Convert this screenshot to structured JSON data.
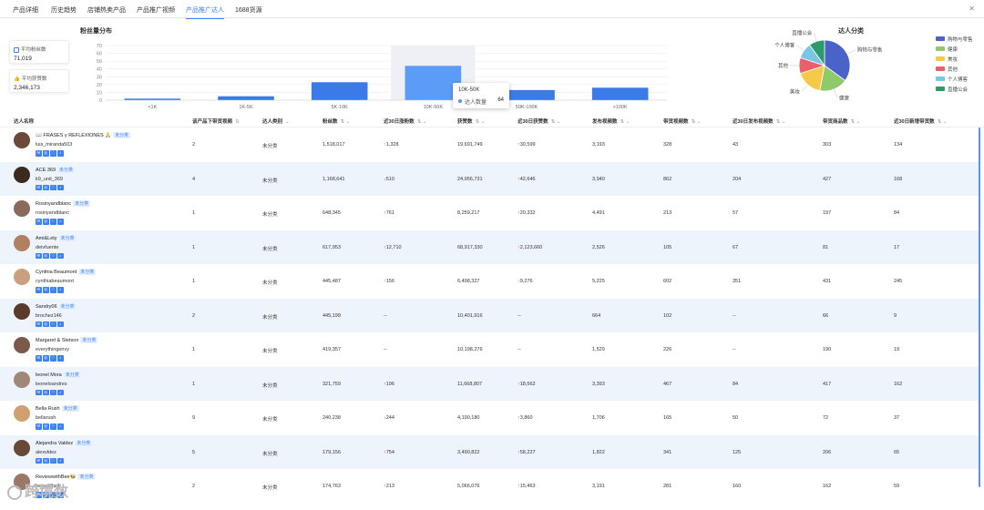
{
  "tabs": [
    "产品详细",
    "历史趋势",
    "店铺热卖产品",
    "产品推广视频",
    "产品推广达人",
    "1688货源"
  ],
  "active_tab": 4,
  "cards": [
    {
      "label": "平均粉丝数",
      "value": "71,019"
    },
    {
      "label": "平均获赞数",
      "value": "2,346,173"
    }
  ],
  "bar_title": "粉丝量分布",
  "pie_title": "达人分类",
  "chart_data": [
    {
      "type": "bar",
      "title": "粉丝量分布",
      "categories": [
        "<1K",
        "1K-5K",
        "5K-10K",
        "10K-50K",
        "50K-100K",
        ">100K"
      ],
      "values": [
        2,
        5,
        23,
        44,
        13,
        16
      ],
      "ylim": [
        0,
        70
      ],
      "yticks": [
        0,
        10,
        20,
        30,
        40,
        50,
        60,
        70
      ],
      "color": "#3b7be8",
      "highlight": {
        "category": "10K-50K",
        "label": "达人数量",
        "value": "64"
      }
    },
    {
      "type": "pie",
      "title": "达人分类",
      "slices": [
        {
          "name": "购物与零售",
          "value": 35,
          "color": "#4a63c8"
        },
        {
          "name": "健康",
          "value": 18,
          "color": "#8fc96a"
        },
        {
          "name": "美妆",
          "value": 17,
          "color": "#f7c948"
        },
        {
          "name": "其他",
          "value": 10,
          "color": "#e9606a"
        },
        {
          "name": "个人博客",
          "value": 10,
          "color": "#79c5e3"
        },
        {
          "name": "直播公会",
          "value": 10,
          "color": "#2d9a6a"
        }
      ]
    }
  ],
  "columns": [
    "达人名称",
    "该产品下带货视频",
    "达人类别",
    "粉丝数",
    "近30日涨粉数",
    "获赞数",
    "近30日获赞数",
    "发布视频数",
    "带货视频数",
    "近30日发布视频数",
    "带货商品数",
    "近30日新增带货数"
  ],
  "rows": [
    {
      "name": "📖 FRASES y REFLEXIONES 🙏",
      "tag": "未分类",
      "acct": "luis_miranda503",
      "avatar": "#6b4a3a",
      "videos": "2",
      "cat": "未分类",
      "fans": "1,518,017",
      "fans30": "↑1,328",
      "likes": "19,691,749",
      "likes30": "↑30,599",
      "posts": "3,193",
      "goods_videos": "328",
      "posts30": "43",
      "goods": "303",
      "goods30": "134"
    },
    {
      "name": "ACE 369",
      "tag": "未分类",
      "acct": "k9_unit_369",
      "avatar": "#3a2a20",
      "videos": "4",
      "cat": "未分类",
      "fans": "1,168,641",
      "fans30": "↓510",
      "likes": "24,956,731",
      "likes30": "↑42,646",
      "posts": "3,940",
      "goods_videos": "862",
      "posts30": "204",
      "goods": "427",
      "goods30": "168"
    },
    {
      "name": "Rosinyandblanc",
      "tag": "未分类",
      "acct": "rosinyandblanc",
      "avatar": "#8a6a5a",
      "videos": "1",
      "cat": "未分类",
      "fans": "648,345",
      "fans30": "↑761",
      "likes": "8,259,217",
      "likes30": "↑20,332",
      "posts": "4,491",
      "goods_videos": "213",
      "posts30": "57",
      "goods": "197",
      "goods30": "84"
    },
    {
      "name": "Ami&Lety",
      "tag": "未分类",
      "acct": "deivfuente",
      "avatar": "#b08060",
      "videos": "1",
      "cat": "未分类",
      "fans": "617,953",
      "fans30": "↑12,710",
      "likes": "68,917,330",
      "likes30": "↑2,123,660",
      "posts": "2,526",
      "goods_videos": "105",
      "posts30": "67",
      "goods": "81",
      "goods30": "17"
    },
    {
      "name": "Cynthia Beaumont",
      "tag": "未分类",
      "acct": "cynthiabeaumont",
      "avatar": "#c9a080",
      "videos": "1",
      "cat": "未分类",
      "fans": "445,487",
      "fans30": "↑156",
      "likes": "6,498,327",
      "likes30": "↑9,276",
      "posts": "5,225",
      "goods_videos": "602",
      "posts30": "351",
      "goods": "431",
      "goods30": "245"
    },
    {
      "name": "Sandry06",
      "tag": "未分类",
      "acct": "brochez146",
      "avatar": "#5a3a2a",
      "videos": "2",
      "cat": "未分类",
      "fans": "445,199",
      "fans30": "--",
      "likes": "10,401,916",
      "likes30": "--",
      "posts": "664",
      "goods_videos": "102",
      "posts30": "--",
      "goods": "66",
      "goods30": "9"
    },
    {
      "name": "Margaret & Stetson",
      "tag": "未分类",
      "acct": "everythingenvy",
      "avatar": "#7a5a4a",
      "videos": "1",
      "cat": "未分类",
      "fans": "419,357",
      "fans30": "--",
      "likes": "10,198,276",
      "likes30": "--",
      "posts": "1,529",
      "goods_videos": "226",
      "posts30": "--",
      "goods": "190",
      "goods30": "19"
    },
    {
      "name": "leonel Mora",
      "tag": "未分类",
      "acct": "leoneloandres",
      "avatar": "#a08878",
      "videos": "1",
      "cat": "未分类",
      "fans": "321,759",
      "fans30": "↑196",
      "likes": "11,668,807",
      "likes30": "↑18,562",
      "posts": "3,393",
      "goods_videos": "467",
      "posts30": "84",
      "goods": "417",
      "goods30": "162"
    },
    {
      "name": "Bella Rush",
      "tag": "未分类",
      "acct": "bellarush",
      "avatar": "#d0a070",
      "videos": "9",
      "cat": "未分类",
      "fans": "240,238",
      "fans30": "↓244",
      "likes": "4,190,180",
      "likes30": "↑3,860",
      "posts": "1,706",
      "goods_videos": "165",
      "posts30": "50",
      "goods": "72",
      "goods30": "37"
    },
    {
      "name": "Alejandra Valdez",
      "tag": "未分类",
      "acct": "alexvldez",
      "avatar": "#6a4838",
      "videos": "5",
      "cat": "未分类",
      "fans": "179,156",
      "fans30": "↑754",
      "likes": "3,490,822",
      "likes30": "↑58,227",
      "posts": "1,822",
      "goods_videos": "341",
      "posts30": "125",
      "goods": "206",
      "goods30": "65"
    },
    {
      "name": "ReviewwithBee🐝",
      "tag": "未分类",
      "acct": "beeasifbeiji",
      "avatar": "#9a7868",
      "videos": "2",
      "cat": "未分类",
      "fans": "174,763",
      "fans30": "↑213",
      "likes": "5,066,076",
      "likes30": "↑15,463",
      "posts": "3,191",
      "goods_videos": "281",
      "posts30": "160",
      "goods": "162",
      "goods30": "59"
    }
  ],
  "watermark": "跨境数"
}
